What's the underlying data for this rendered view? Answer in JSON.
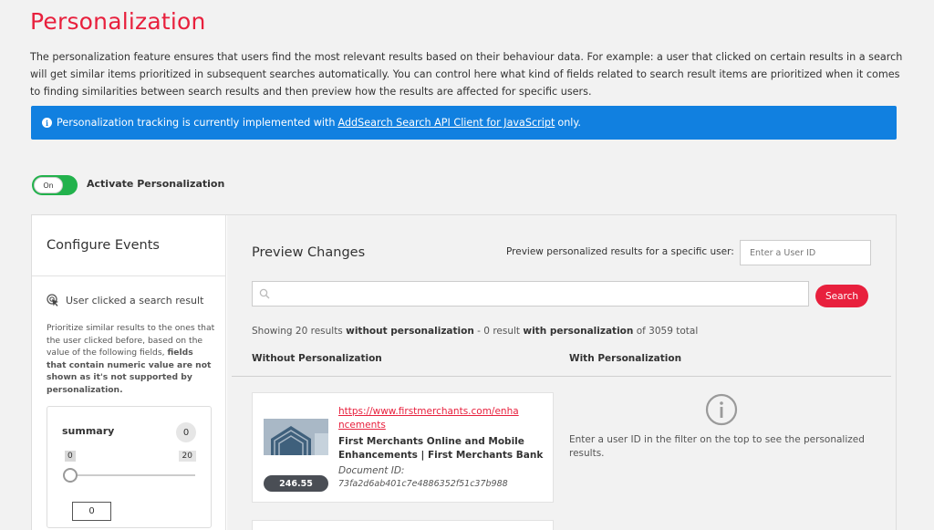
{
  "page": {
    "title": "Personalization",
    "intro": "The personalization feature ensures that users find the most relevant results based on their behaviour data. For example: a user that clicked on certain results in a search will get similar items prioritized in subsequent searches automatically. You can control here what kind of fields related to search result items are prioritized when it comes to finding similarities between search results and then preview how the results are affected for specific users."
  },
  "banner": {
    "icon": "info-icon",
    "prefix": "Personalization tracking is currently implemented with",
    "link": "AddSearch Search API Client for JavaScript",
    "suffix": "only.",
    "color": "#1180e0"
  },
  "activation": {
    "toggle_state": "On",
    "label": "Activate Personalization",
    "toggle_color": "#22b24c"
  },
  "configure": {
    "title": "Configure Events",
    "event_icon": "cursor-click-icon",
    "event_title": "User clicked a search result",
    "description_plain": "Prioritize similar results to the ones that the user clicked before, based on the value of the following fields,",
    "description_bold": "fields that contain numeric value are not shown as it's not supported by personalization.",
    "field": {
      "name": "summary",
      "badge": "0",
      "slider_min": "0",
      "slider_max": "20",
      "value": "0"
    }
  },
  "preview": {
    "title": "Preview Changes",
    "user_label": "Preview personalized results for a specific user:",
    "user_placeholder": "Enter a User ID",
    "search_button": "Search",
    "search_icon": "search-icon",
    "stats": {
      "p1": "Showing 20 results",
      "b1": "without personalization",
      "p2": "- 0 result",
      "b2": "with personalization",
      "p3": "of 3059 total"
    },
    "col_without": "Without Personalization",
    "col_with": "With Personalization",
    "result": {
      "url": "https://www.firstmerchants.com/enhancements",
      "title": "First Merchants Online and Mobile Enhancements | First Merchants Bank",
      "doc_label": "Document ID:",
      "doc_id": "73fa2d6ab401c7e4886352f51c37b988",
      "score": "246.55"
    },
    "with_icon": "info-circle-icon",
    "with_message": "Enter a user ID in the filter on the top to see the personalized results."
  },
  "colors": {
    "accent": "#e8203d",
    "score_bg": "#4a4e55"
  }
}
